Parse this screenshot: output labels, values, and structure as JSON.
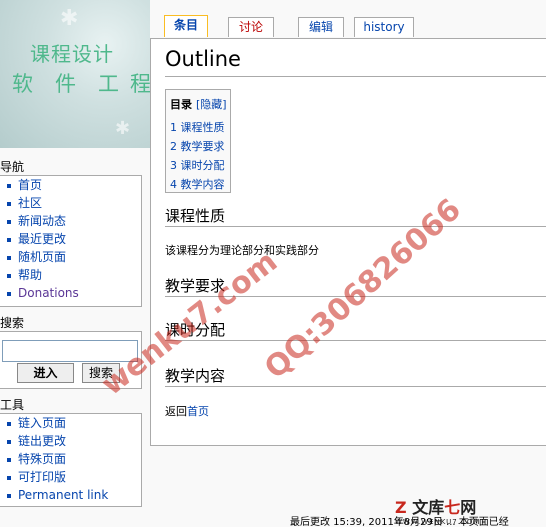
{
  "logo": {
    "line1": "课程设计",
    "line2": "软件工",
    "line3": "程"
  },
  "tabs": [
    {
      "label": "条目"
    },
    {
      "label": "讨论"
    },
    {
      "label": "编辑"
    },
    {
      "label": "history"
    }
  ],
  "page": {
    "title": "Outline"
  },
  "toc": {
    "title": "目录",
    "hide": "[隐藏]",
    "items": [
      "1 课程性质",
      "2 教学要求",
      "3 课时分配",
      "4 教学内容"
    ]
  },
  "sections": [
    {
      "heading": "课程性质",
      "text": "该课程分为理论部分和实践部分"
    },
    {
      "heading": "教学要求"
    },
    {
      "heading": "课时分配"
    },
    {
      "heading": "教学内容"
    }
  ],
  "back": {
    "prefix": "返回",
    "link": "首页"
  },
  "nav": {
    "title": "导航",
    "items": [
      "首页",
      "社区",
      "新闻动态",
      "最近更改",
      "随机页面",
      "帮助",
      "Donations"
    ]
  },
  "search": {
    "title": "搜索",
    "go": "进入",
    "search": "搜索",
    "value": ""
  },
  "tools": {
    "title": "工具",
    "items": [
      "链入页面",
      "链出更改",
      "特殊页面",
      "可打印版",
      "Permanent link"
    ]
  },
  "watermark": {
    "left": "wenku7.com",
    "right": "QQ:306826066",
    "brand_left": "文库",
    "brand_mark": "七",
    "brand_right": "网",
    "url": "WWW.WENKU7.COM"
  },
  "footer": {
    "text": "最后更改 15:39, 2011年8月29日 ... 本页面已经"
  }
}
